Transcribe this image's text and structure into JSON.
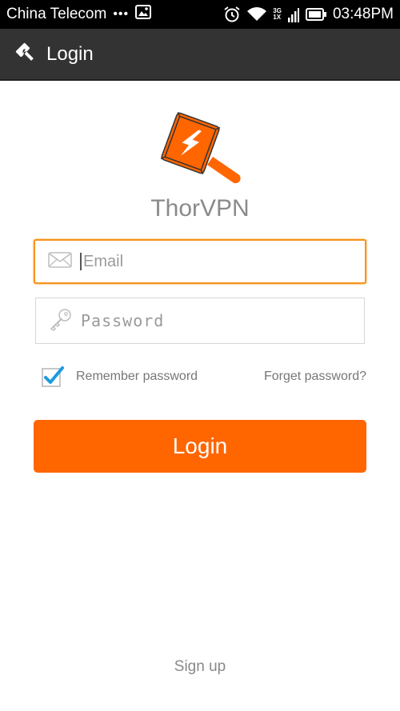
{
  "status_bar": {
    "carrier": "China Telecom",
    "dots": "•••",
    "network_top": "3G",
    "network_bottom": "1X",
    "time": "03:48PM"
  },
  "action_bar": {
    "title": "Login",
    "icon": "hammer-icon"
  },
  "app": {
    "name": "ThorVPN",
    "logo_color": "#ff6600"
  },
  "form": {
    "email_placeholder": "Email",
    "password_placeholder": "Password",
    "remember_label": "Remember password",
    "remember_checked": true,
    "forget_label": "Forget password?",
    "login_label": "Login"
  },
  "footer": {
    "signup_label": "Sign up"
  },
  "colors": {
    "accent": "#ff6600",
    "focus_border": "#f7941d",
    "action_bar": "#333333",
    "checkbox_check": "#1a9be0"
  }
}
